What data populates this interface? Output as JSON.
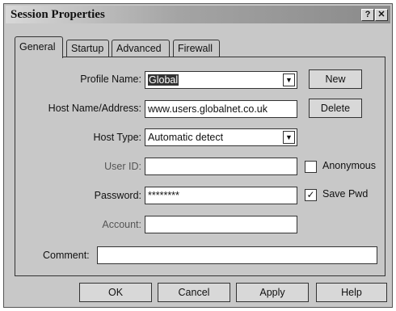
{
  "window": {
    "title": "Session Properties",
    "help_glyph": "?",
    "close_glyph": "✕"
  },
  "tabs": [
    "General",
    "Startup",
    "Advanced",
    "Firewall"
  ],
  "fields": {
    "profile_name": {
      "label": "Profile Name:",
      "value": "Global"
    },
    "host": {
      "label": "Host Name/Address:",
      "value": "www.users.globalnet.co.uk"
    },
    "host_type": {
      "label": "Host Type:",
      "value": "Automatic detect"
    },
    "user_id": {
      "label": "User ID:",
      "value": ""
    },
    "password": {
      "label": "Password:",
      "value": "********"
    },
    "account": {
      "label": "Account:",
      "value": ""
    },
    "comment": {
      "label": "Comment:",
      "value": ""
    }
  },
  "side_buttons": {
    "new": "New",
    "delete": "Delete"
  },
  "checkboxes": {
    "anonymous": {
      "label": "Anonymous",
      "checked": false,
      "mark": ""
    },
    "save_pwd": {
      "label": "Save Pwd",
      "checked": true,
      "mark": "✓"
    }
  },
  "buttons": {
    "ok": "OK",
    "cancel": "Cancel",
    "apply": "Apply",
    "help": "Help"
  },
  "icons": {
    "dropdown": "▼"
  }
}
